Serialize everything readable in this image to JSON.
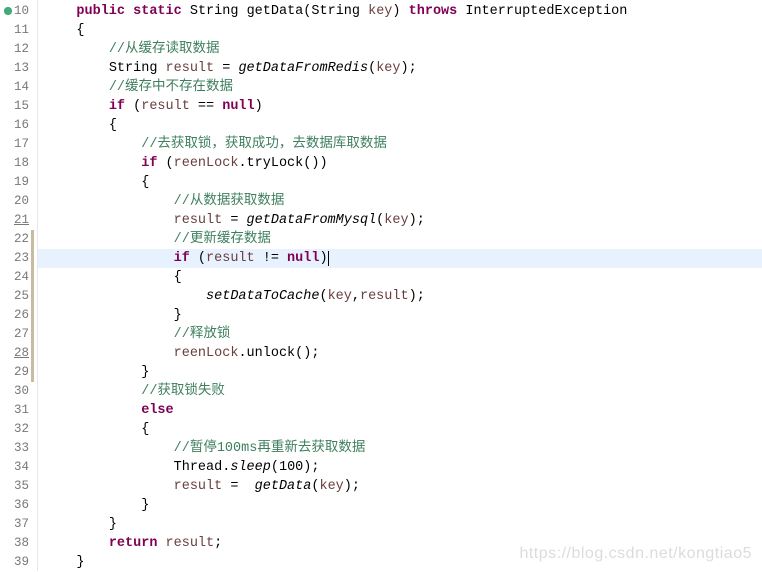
{
  "watermark": "https://blog.csdn.net/kongtiao5",
  "gutter": {
    "start": 10,
    "end": 39,
    "underlined": [
      21,
      28
    ],
    "modifiedRange": [
      22,
      29
    ],
    "overrideIconAt": 10,
    "highlight": 23
  },
  "code": {
    "k_public": "public",
    "k_static": "static",
    "k_throws": "throws",
    "k_if": "if",
    "k_else": "else",
    "k_null": "null",
    "k_return": "return",
    "t_String": "String",
    "t_IE": "InterruptedException",
    "t_Thread": "Thread",
    "sig_name": "getData",
    "sig_open": "(",
    "sig_param_type": "String",
    "sig_param_name": "key",
    "sig_close": ")",
    "brace_open": "{",
    "brace_close": "}",
    "c12": "//从缓存读取数据",
    "l13_decl": "String ",
    "l13_var": "result",
    "l13_eq": " = ",
    "l13_mth": "getDataFromRedis",
    "l13_arg_open": "(",
    "l13_arg": "key",
    "l13_arg_close": ");",
    "c14": "//缓存中不存在数据",
    "l15_cond_open": " (",
    "l15_var": "result",
    "l15_op": " == ",
    "l15_cond_close": ")",
    "c17": "//去获取锁，获取成功，去数据库取数据",
    "l18_cond_open": " (",
    "l18_obj": "reenLock",
    "l18_dot": ".",
    "l18_mth": "tryLock",
    "l18_call": "())",
    "c20": "//从数据获取数据",
    "l21_var": "result",
    "l21_eq": " = ",
    "l21_mth": "getDataFromMysql",
    "l21_open": "(",
    "l21_arg": "key",
    "l21_close": ");",
    "c22": "//更新缓存数据",
    "l23_cond_open": " (",
    "l23_var": "result",
    "l23_op": " != ",
    "l23_cond_close": ")",
    "l25_mth": "setDataToCache",
    "l25_open": "(",
    "l25_arg1": "key",
    "l25_comma": ",",
    "l25_arg2": "result",
    "l25_close": ");",
    "c27": "//释放锁",
    "l28_obj": "reenLock",
    "l28_dot": ".",
    "l28_mth": "unlock",
    "l28_call": "();",
    "c30": "//获取锁失败",
    "c33": "//暂停100ms再重新去获取数据",
    "l34_obj": "Thread",
    "l34_dot": ".",
    "l34_mth": "sleep",
    "l34_open": "(",
    "l34_num": "100",
    "l34_close": ");",
    "l35_var": "result",
    "l35_eq": " =  ",
    "l35_mth": "getData",
    "l35_open": "(",
    "l35_arg": "key",
    "l35_close": ");",
    "l38_var": "result",
    "l38_semi": ";"
  },
  "indent": {
    "i1": "    ",
    "i2": "        ",
    "i3": "            ",
    "i4": "                ",
    "i5": "                    ",
    "i6": "                        "
  }
}
